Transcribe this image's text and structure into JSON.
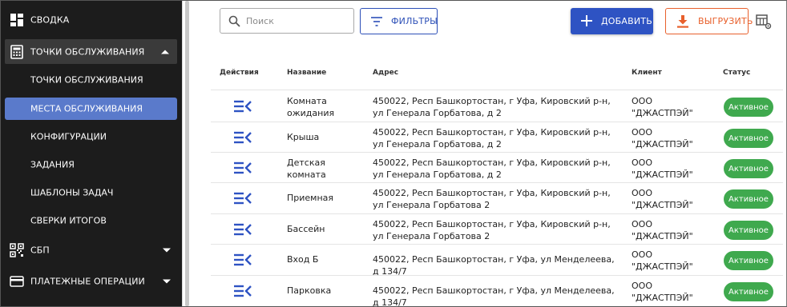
{
  "sidebar": {
    "items": [
      {
        "label": "СВОДКА",
        "icon": "dashboard-icon"
      },
      {
        "label": "ТОЧКИ ОБСЛУЖИВАНИЯ",
        "icon": "cash-register-icon",
        "expanded": true
      },
      {
        "label": "СБП",
        "icon": "qr-code-icon"
      },
      {
        "label": "ПЛАТЕЖНЫЕ ОПЕРАЦИИ",
        "icon": "credit-card-icon"
      }
    ],
    "subitems": [
      {
        "label": "ТОЧКИ ОБСЛУЖИВАНИЯ"
      },
      {
        "label": "МЕСТА ОБСЛУЖИВАНИЯ",
        "active": true
      },
      {
        "label": "КОНФИГУРАЦИИ"
      },
      {
        "label": "ЗАДАНИЯ"
      },
      {
        "label": "ШАБЛОНЫ ЗАДАЧ"
      },
      {
        "label": "СВЕРКИ ИТОГОВ"
      }
    ]
  },
  "toolbar": {
    "search_placeholder": "Поиск",
    "filter_label": "ФИЛЬТРЫ",
    "add_label": "ДОБАВИТЬ",
    "export_label": "ВЫГРУЗИТЬ"
  },
  "table": {
    "headers": {
      "actions": "Действия",
      "name": "Название",
      "address": "Адрес",
      "client": "Клиент",
      "status": "Статус"
    },
    "rows": [
      {
        "name": "Комната ожидания",
        "address": "450022, Респ Башкортостан, г Уфа, Кировский р-н, ул Генерала Горбатова, д 2",
        "client": "ООО \"ДЖАСТПЭЙ\"",
        "status": "Активное"
      },
      {
        "name": "Крыша",
        "address": "450022, Респ Башкортостан, г Уфа, Кировский р-н, ул Генерала Горбатова, д 2",
        "client": "ООО \"ДЖАСТПЭЙ\"",
        "status": "Активное"
      },
      {
        "name": "Детская комната",
        "address": "450022, Респ Башкортостан, г Уфа, Кировский р-н, ул Генерала Горбатова, д 2",
        "client": "ООО \"ДЖАСТПЭЙ\"",
        "status": "Активное"
      },
      {
        "name": "Приемная",
        "address": "450022, Респ Башкортостан, г Уфа, Кировский р-н, ул Генерала Горбатова 2",
        "client": "ООО \"ДЖАСТПЭЙ\"",
        "status": "Активное"
      },
      {
        "name": "Бассейн",
        "address": "450022, Респ Башкортостан, г Уфа, Кировский р-н, ул Генерала Горбатова 2",
        "client": "ООО \"ДЖАСТПЭЙ\"",
        "status": "Активное"
      },
      {
        "name": "Вход Б",
        "address": "450022, Респ Башкортостан, г Уфа, ул Менделеева, д 134/7",
        "client": "ООО \"ДЖАСТПЭЙ\"",
        "status": "Активное"
      },
      {
        "name": "Парковка",
        "address": "450022, Респ Башкортостан, г Уфа, ул Менделеева, д 134/7",
        "client": "ООО \"ДЖАСТПЭЙ\"",
        "status": "Активное"
      }
    ]
  },
  "colors": {
    "sidebar_bg": "#1c1c1c",
    "active_item": "#5a7acb",
    "primary": "#2e53c3",
    "export": "#e8602c",
    "status_active": "#3fa94e"
  }
}
